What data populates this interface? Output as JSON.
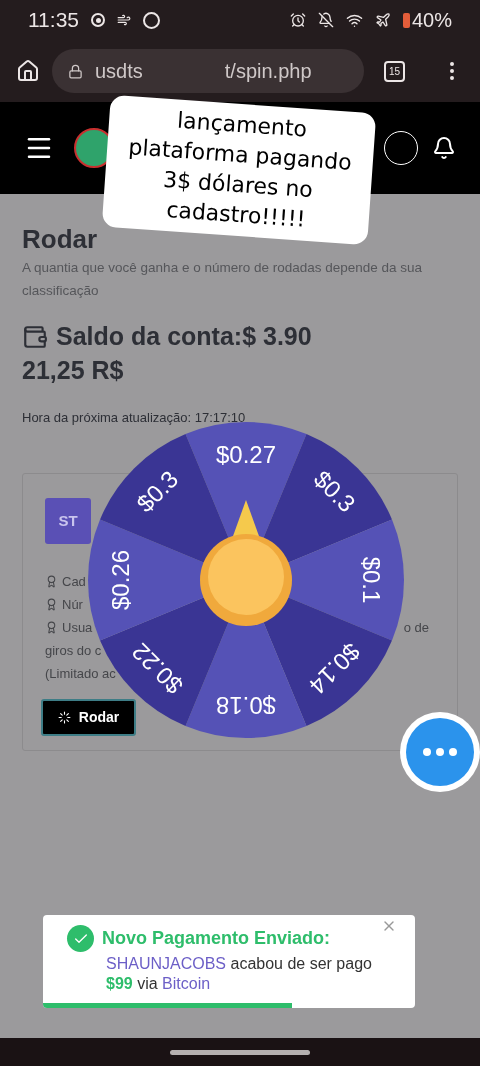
{
  "status_bar": {
    "time": "11:35",
    "battery": "40%"
  },
  "browser": {
    "url_start": "usdts",
    "url_end": "t/spin.php",
    "tab_count": "15"
  },
  "caption": "lançamento plataforma pagando 3$ dólares no cadastro!!!!!",
  "page": {
    "title": "Rodar",
    "subtitle": "A quantia que você ganha e o número de rodadas depende da sua classificação",
    "balance": "Saldo da conta:$ 3.90",
    "balance_brl": "21,25 R$",
    "next_update": "Hora da próxima atualização: 17:17:10"
  },
  "card": {
    "avatar": "ST",
    "lines": [
      {
        "text": "Cad"
      },
      {
        "text": "Núr"
      },
      {
        "text": "Usua",
        "tail": "o de"
      },
      {
        "text": "giros do c"
      },
      {
        "text": "(Limitado ac"
      }
    ],
    "button": "Rodar"
  },
  "wheel": {
    "segments": [
      "$0.27",
      "$0.3",
      "$0.1",
      "$0.14",
      "$0.18",
      "$0.22",
      "$0.26",
      "$0.3"
    ]
  },
  "toast": {
    "title": "Novo Pagamento Enviado:",
    "user": "SHAUNJACOBS",
    "text_1": "acabou de ser pago",
    "amount": "$99",
    "text_2": "via",
    "method": "Bitcoin",
    "level": 0.67
  }
}
